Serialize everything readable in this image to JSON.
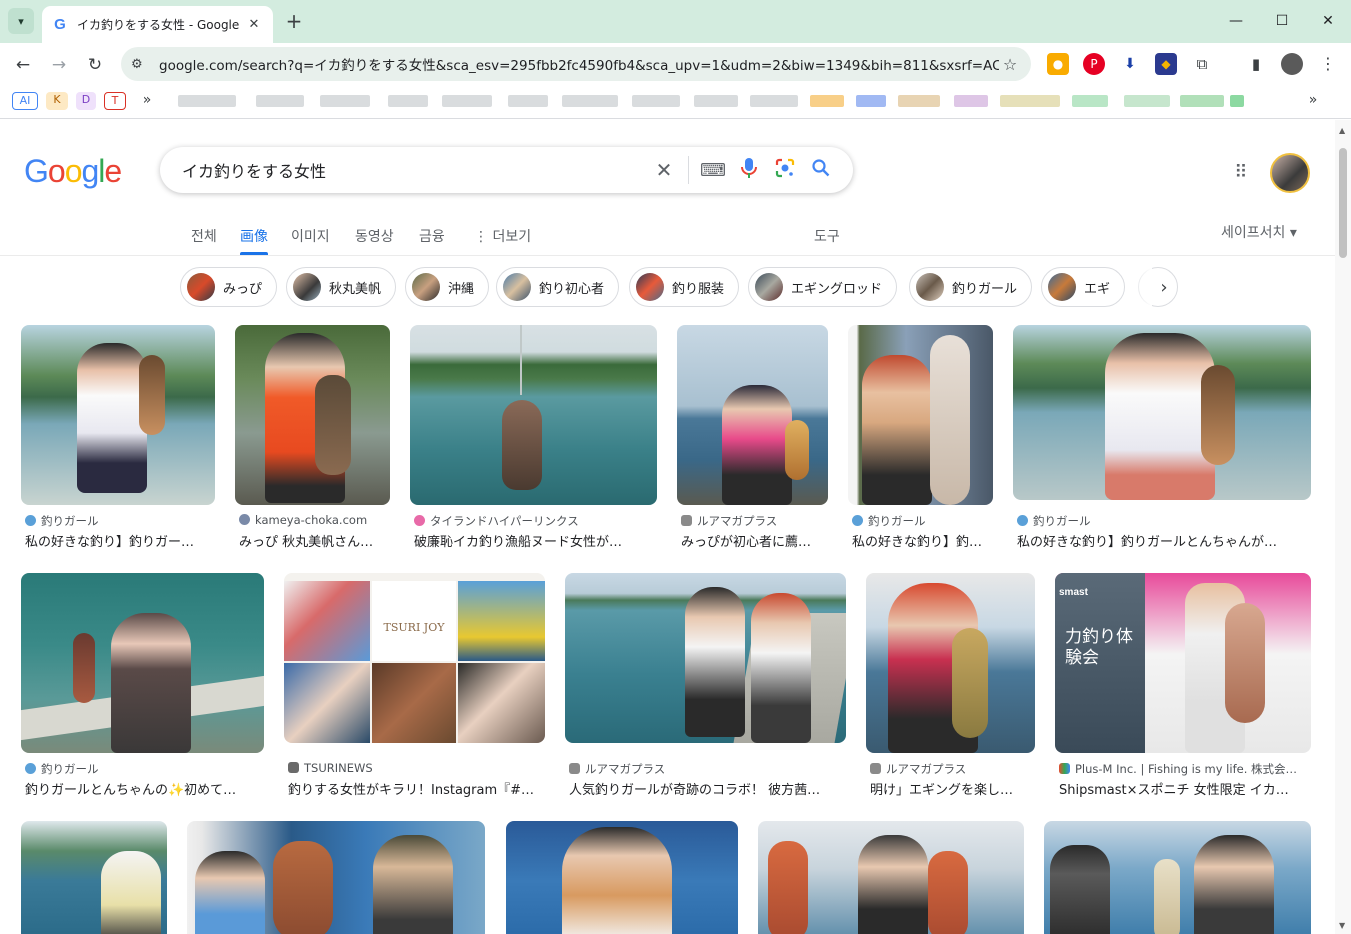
{
  "browser": {
    "tab_title": "イカ釣りをする女性 - Google",
    "tab_favicon": "G",
    "new_tab": "+",
    "url": "google.com/search?q=イカ釣りをする女性&sca_esv=295fbb2fc4590fb4&sca_upv=1&udm=2&biw=1349&bih=811&sxsrf=ACQVn...",
    "window_controls": {
      "minimize": "—",
      "maximize": "☐",
      "close": "✕"
    },
    "bookmarks_visible": [
      "AI",
      "K",
      "D",
      "T"
    ],
    "bookmarks_more": "»"
  },
  "search": {
    "logo": [
      "G",
      "o",
      "o",
      "g",
      "l",
      "e"
    ],
    "logo_colors": [
      "#4285f4",
      "#ea4335",
      "#fbbc05",
      "#4285f4",
      "#34a853",
      "#ea4335"
    ],
    "query": "イカ釣りをする女性"
  },
  "nav": {
    "tabs": [
      "전체",
      "画像",
      "이미지",
      "동영상",
      "금융",
      "⋮ 더보기"
    ],
    "active": "画像",
    "tools": "도구",
    "safesearch": "세이프서치 ▾"
  },
  "chips": [
    "みっぴ",
    "秋丸美帆",
    "沖縄",
    "釣り初心者",
    "釣り服装",
    "エギングロッド",
    "釣りガール",
    "エギ"
  ],
  "results": [
    {
      "source": "釣りガール",
      "title": "私の好きな釣り】釣りガー…"
    },
    {
      "source": "kameya-choka.com",
      "title": "みっぴ 秋丸美帆さん…"
    },
    {
      "source": "タイランドハイパーリンクス",
      "title": "破廉恥イカ釣り漁船ヌード女性が…"
    },
    {
      "source": "ルアマガプラス",
      "title": "みっぴが初心者に薦…"
    },
    {
      "source": "釣りガール",
      "title": "私の好きな釣り】釣…"
    },
    {
      "source": "釣りガール",
      "title": "私の好きな釣り】釣りガールとんちゃんが…"
    },
    {
      "source": "釣りガール",
      "title": "釣りガールとんちゃんの✨初めて…"
    },
    {
      "source": "TSURINEWS",
      "title": "釣りする女性がキラリ！Instagram『#…"
    },
    {
      "source": "ルアマガプラス",
      "title": "人気釣りガールが奇跡のコラボ！ 彼方茜…"
    },
    {
      "source": "ルアマガプラス",
      "title": "明け」エギングを楽し…"
    },
    {
      "source": "Plus-M Inc. | Fishing is my life. 株式会…",
      "title": "Shipsmast×スポニチ 女性限定 イカ…"
    }
  ],
  "image_texts": {
    "tsuri_joy": "TSURI JOY",
    "shipsmast_banner": "smast",
    "ika_event": "力釣り体験会"
  }
}
